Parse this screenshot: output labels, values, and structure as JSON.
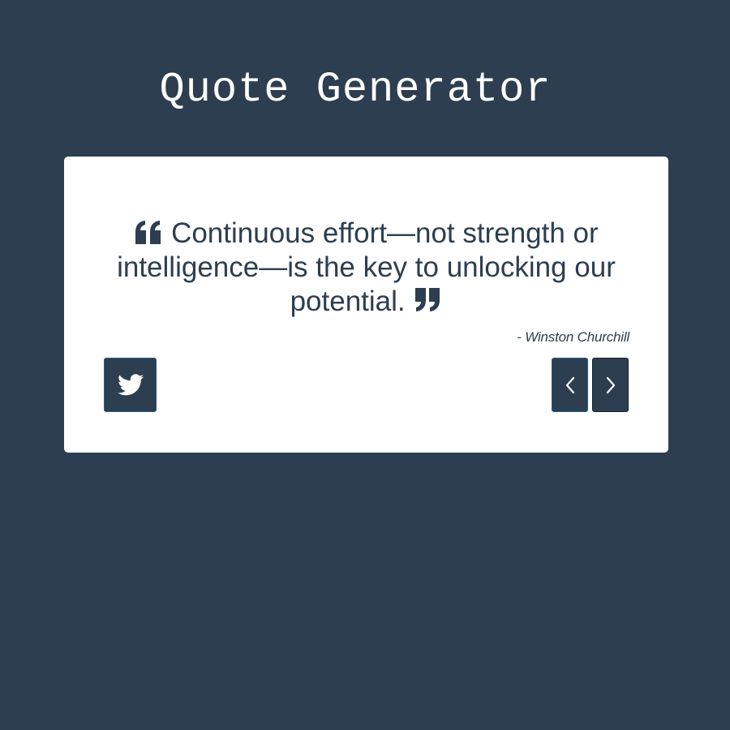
{
  "header": {
    "title": "Quote Generator"
  },
  "quote": {
    "text": "Continuous effort—not strength or intelligence—is the key to unlocking our potential.",
    "author": "- Winston Churchill",
    "open_icon": "quote-left-icon",
    "close_icon": "quote-right-icon"
  },
  "actions": {
    "tweet_icon": "twitter-icon",
    "prev_icon": "chevron-left-icon",
    "next_icon": "chevron-right-icon"
  },
  "colors": {
    "background": "#2d3e50",
    "card": "#ffffff",
    "text": "#2d3e50",
    "button": "#2d3e50",
    "button_border": "#1f5f85"
  }
}
